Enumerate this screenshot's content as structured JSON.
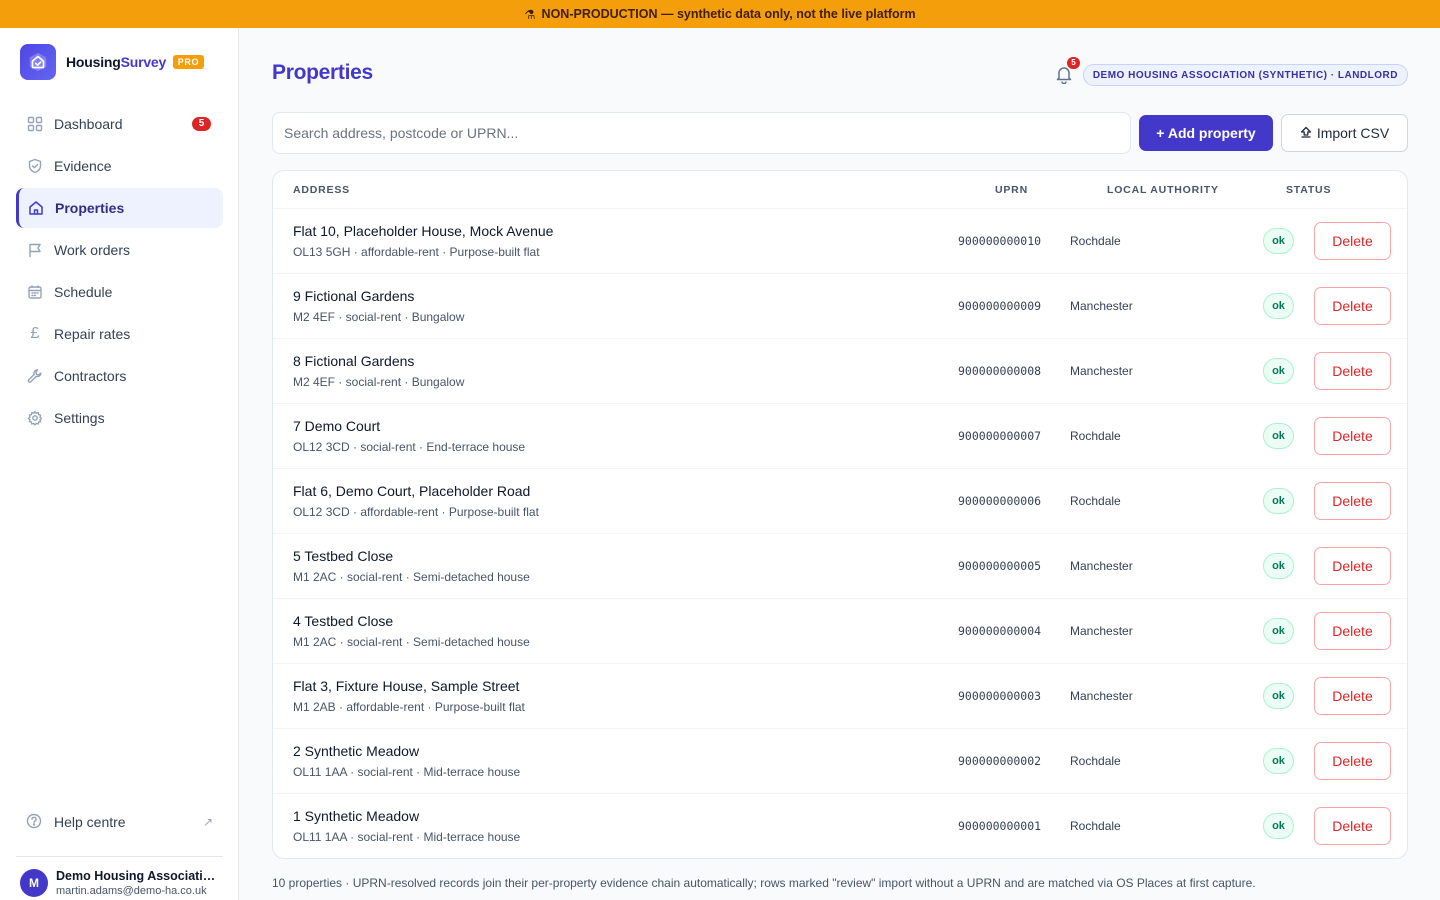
{
  "banner": {
    "text": "NON-PRODUCTION — synthetic data only, not the live platform"
  },
  "brand": {
    "name_part1": "Housing",
    "name_part2": "Survey",
    "badge": "PRO"
  },
  "sidebar": {
    "items": [
      {
        "label": "Dashboard",
        "badge": "5"
      },
      {
        "label": "Evidence"
      },
      {
        "label": "Properties"
      },
      {
        "label": "Work orders"
      },
      {
        "label": "Schedule"
      },
      {
        "label": "Repair rates"
      },
      {
        "label": "Contractors"
      },
      {
        "label": "Settings"
      }
    ],
    "active": "Properties",
    "help_label": "Help centre"
  },
  "user": {
    "initial": "M",
    "org": "Demo Housing Association (Synthetic)",
    "email": "martin.adams@demo-ha.co.uk"
  },
  "header": {
    "title": "Properties",
    "notification_count": "5",
    "org_pill": "DEMO HOUSING ASSOCIATION (SYNTHETIC) · LANDLORD"
  },
  "toolbar": {
    "search_placeholder": "Search address, postcode or UPRN...",
    "add_label": "+ Add property",
    "import_label": "Import CSV"
  },
  "table": {
    "columns": {
      "address": "ADDRESS",
      "uprn": "UPRN",
      "authority": "LOCAL AUTHORITY",
      "status": "STATUS"
    },
    "delete_label": "Delete",
    "rows": [
      {
        "address": "Flat 10, Placeholder House, Mock Avenue",
        "details": "OL13 5GH · affordable-rent · Purpose-built flat",
        "uprn": "900000000010",
        "authority": "Rochdale",
        "status": "ok"
      },
      {
        "address": "9 Fictional Gardens",
        "details": "M2 4EF · social-rent · Bungalow",
        "uprn": "900000000009",
        "authority": "Manchester",
        "status": "ok"
      },
      {
        "address": "8 Fictional Gardens",
        "details": "M2 4EF · social-rent · Bungalow",
        "uprn": "900000000008",
        "authority": "Manchester",
        "status": "ok"
      },
      {
        "address": "7 Demo Court",
        "details": "OL12 3CD · social-rent · End-terrace house",
        "uprn": "900000000007",
        "authority": "Rochdale",
        "status": "ok"
      },
      {
        "address": "Flat 6, Demo Court, Placeholder Road",
        "details": "OL12 3CD · affordable-rent · Purpose-built flat",
        "uprn": "900000000006",
        "authority": "Rochdale",
        "status": "ok"
      },
      {
        "address": "5 Testbed Close",
        "details": "M1 2AC · social-rent · Semi-detached house",
        "uprn": "900000000005",
        "authority": "Manchester",
        "status": "ok"
      },
      {
        "address": "4 Testbed Close",
        "details": "M1 2AC · social-rent · Semi-detached house",
        "uprn": "900000000004",
        "authority": "Manchester",
        "status": "ok"
      },
      {
        "address": "Flat 3, Fixture House, Sample Street",
        "details": "M1 2AB · affordable-rent · Purpose-built flat",
        "uprn": "900000000003",
        "authority": "Manchester",
        "status": "ok"
      },
      {
        "address": "2 Synthetic Meadow",
        "details": "OL11 1AA · social-rent · Mid-terrace house",
        "uprn": "900000000002",
        "authority": "Rochdale",
        "status": "ok"
      },
      {
        "address": "1 Synthetic Meadow",
        "details": "OL11 1AA · social-rent · Mid-terrace house",
        "uprn": "900000000001",
        "authority": "Rochdale",
        "status": "ok"
      }
    ]
  },
  "footnote": "10 properties · UPRN-resolved records join their per-property evidence chain automatically; rows marked \"review\" import without a UPRN and are matched via OS Places at first capture."
}
